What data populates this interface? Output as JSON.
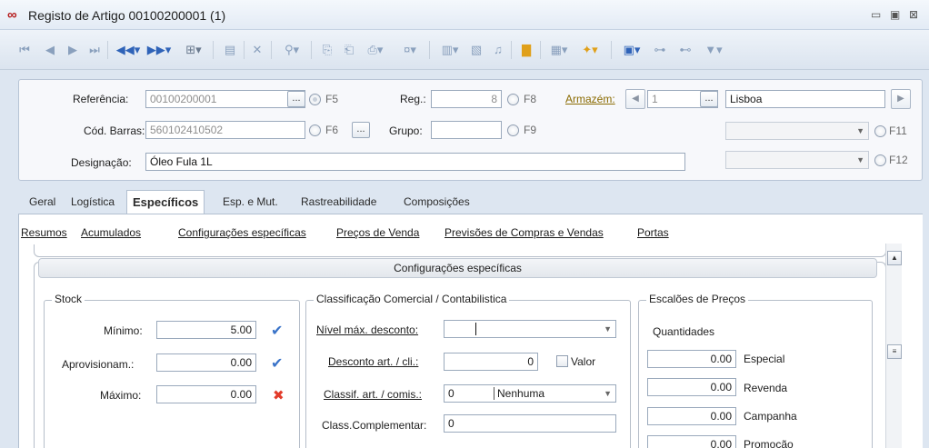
{
  "window": {
    "title": "Registo de Artigo 00100200001 (1)",
    "icon": "infinity-logo-icon",
    "controls": [
      "minimize-icon",
      "restore-icon",
      "close-icon"
    ]
  },
  "header": {
    "referencia": {
      "label": "Referência:",
      "value": "00100200001",
      "shortcut": "F5"
    },
    "cod_barras": {
      "label": "Cód. Barras:",
      "value": "560102410502",
      "shortcut": "F6"
    },
    "designacao": {
      "label": "Designação:",
      "value": "Óleo Fula 1L"
    },
    "reg": {
      "label": "Reg.:",
      "value": "8",
      "shortcut": "F8"
    },
    "grupo": {
      "label": "Grupo:",
      "value": "",
      "shortcut": "F9"
    },
    "armazem": {
      "label": "Armazém:",
      "value": "1",
      "name": "Lisboa"
    },
    "combo1": {
      "value": "",
      "shortcut": "F11"
    },
    "combo2": {
      "value": "",
      "shortcut": "F12"
    },
    "ellipsis": "..."
  },
  "tabs": [
    {
      "label": "Geral"
    },
    {
      "label": "Logística"
    },
    {
      "label": "Específicos",
      "active": true
    },
    {
      "label": "Esp. e Mut."
    },
    {
      "label": "Rastreabilidade"
    },
    {
      "label": "Composições"
    }
  ],
  "sublinks": [
    "Resumos",
    "Acumulados",
    "Configurações específicas",
    "Preços de Venda",
    "Previsões de Compras e Vendas",
    "Portas"
  ],
  "section_title": "Configurações específicas",
  "stock": {
    "title": "Stock",
    "minimo": {
      "label": "Mínimo:",
      "value": "5.00",
      "status": "check-icon"
    },
    "aprovisionam": {
      "label": "Aprovisionam.:",
      "value": "0.00",
      "status": "check-icon"
    },
    "maximo": {
      "label": "Máximo:",
      "value": "0.00",
      "status": "x-icon"
    }
  },
  "classificacao": {
    "title": "Classificação Comercial / Contabilistica",
    "nivel_max_desconto": {
      "label": "Nível máx. desconto:",
      "value": ""
    },
    "desconto": {
      "label": "Desconto art. / cli.:",
      "value": "0",
      "checkbox_label": "Valor"
    },
    "classif": {
      "label": "Classif. art. / comis.:",
      "code": "0",
      "value": "Nenhuma"
    },
    "complementar": {
      "label": "Class.Complementar:",
      "value": "0"
    }
  },
  "escaloes": {
    "title": "Escalões de Preços",
    "subtitle": "Quantidades",
    "rows": [
      {
        "value": "0.00",
        "label": "Especial"
      },
      {
        "value": "0.00",
        "label": "Revenda"
      },
      {
        "value": "0.00",
        "label": "Campanha"
      },
      {
        "value": "0.00",
        "label": "Promoção"
      }
    ]
  }
}
